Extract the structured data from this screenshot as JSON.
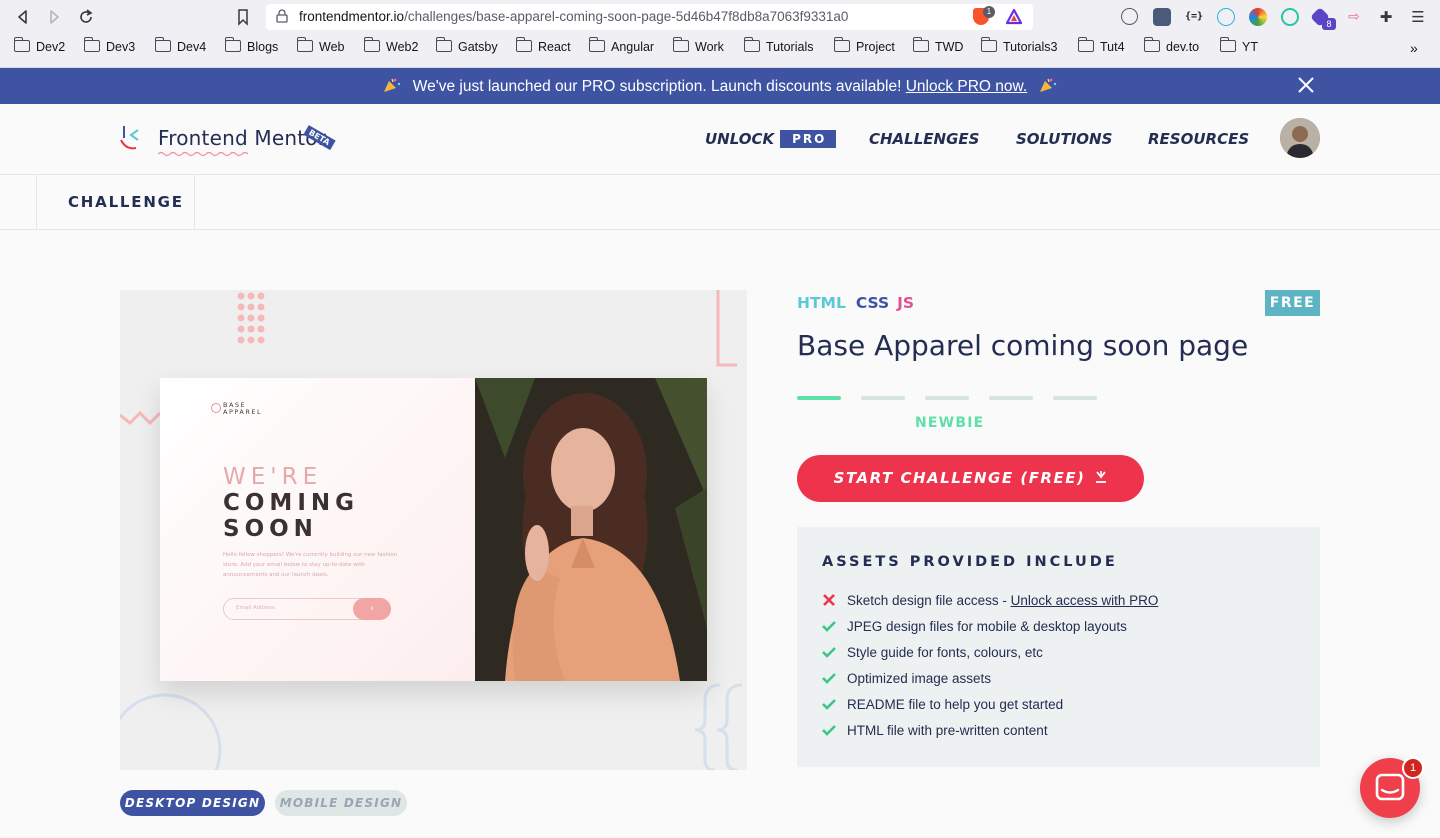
{
  "browser": {
    "url_host": "frontendmentor.io",
    "url_path": "/challenges/base-apparel-coming-soon-page-5d46b47f8db8a7063f9331a0",
    "shield_count": "1",
    "ext_badge": "8",
    "bookmarks": [
      "Dev2",
      "Dev3",
      "Dev4",
      "Blogs",
      "Web",
      "Web2",
      "Gatsby",
      "React",
      "Angular",
      "Work",
      "Tutorials",
      "Project",
      "TWD",
      "Tutorials3",
      "Tut4",
      "dev.to",
      "YT"
    ],
    "overflow": "»"
  },
  "promo": {
    "text": "We've just launched our PRO subscription. Launch discounts available! ",
    "link": "Unlock PRO now."
  },
  "header": {
    "logo_text": "Frontend Mentor",
    "beta": "BETA",
    "nav": {
      "unlock": "UNLOCK",
      "pro": "PRO",
      "challenges": "CHALLENGES",
      "solutions": "SOLUTIONS",
      "resources": "RESOURCES"
    }
  },
  "subnav": {
    "tab": "CHALLENGE"
  },
  "preview": {
    "brand_line1": "BASE",
    "brand_line2": "APPAREL",
    "heading_light": "WE'RE",
    "heading_dark1": "COMING",
    "heading_dark2": "SOON",
    "paragraph": "Hello fellow shoppers! We're currently building our new fashion store. Add your email below to stay up-to-date with announcements and our launch deals.",
    "input_placeholder": "Email Address",
    "button_glyph": "›"
  },
  "challenge": {
    "langs": [
      "HTML",
      "CSS",
      "JS"
    ],
    "badge": "FREE",
    "title": "Base Apparel coming soon page",
    "difficulty_level": 1,
    "difficulty_steps": 5,
    "difficulty_label": "NEWBIE",
    "start_button": "START CHALLENGE (FREE)",
    "assets_heading": "ASSETS PROVIDED INCLUDE",
    "assets": [
      {
        "text": "Sketch design file access - ",
        "link": "Unlock access with PRO",
        "included": false
      },
      {
        "text": "JPEG design files for mobile & desktop layouts",
        "included": true
      },
      {
        "text": "Style guide for fonts, colours, etc",
        "included": true
      },
      {
        "text": "Optimized image assets",
        "included": true
      },
      {
        "text": "README file to help you get started",
        "included": true
      },
      {
        "text": "HTML file with pre-written content",
        "included": true
      }
    ]
  },
  "design_toggle": {
    "desktop": "DESKTOP DESIGN",
    "mobile": "MOBILE DESIGN",
    "active": "desktop"
  },
  "chat": {
    "badge": "1"
  },
  "colors": {
    "primary": "#3e54a3",
    "accent": "#ee344d",
    "success": "#5fe0a8",
    "free": "#5db4c3"
  }
}
